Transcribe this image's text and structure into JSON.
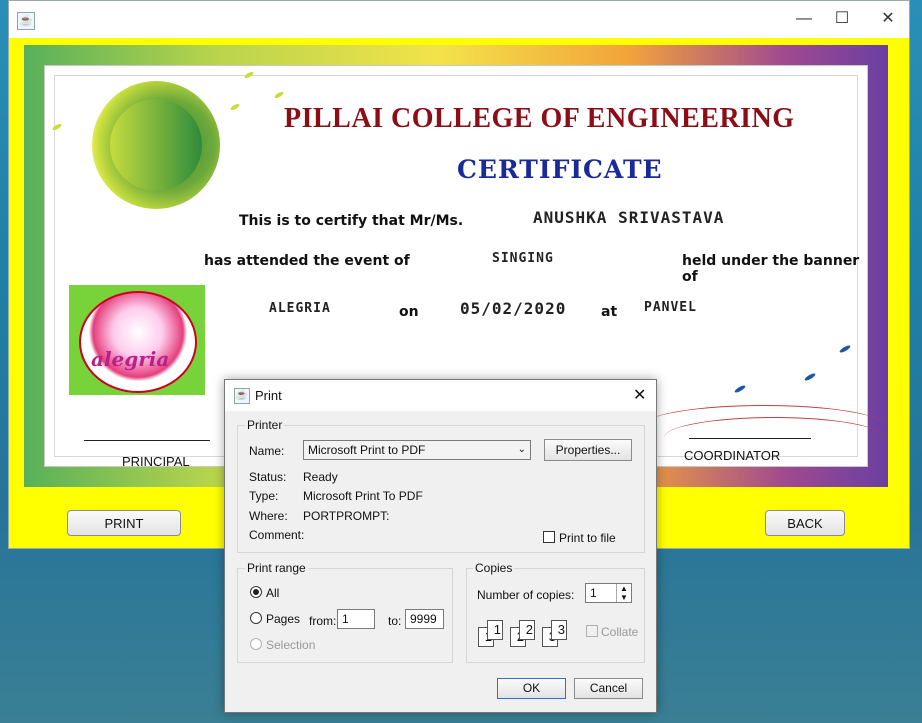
{
  "window": {
    "app_icon": "java-icon",
    "minimize_glyph": "—",
    "maximize_glyph": "☐",
    "close_glyph": "✕"
  },
  "certificate": {
    "college": "PILLAI COLLEGE OF ENGINEERING",
    "title": "CERTIFICATE",
    "line1_label": "This is to certify that Mr/Ms.",
    "name": "ANUSHKA SRIVASTAVA",
    "line2_label": "has attended the event of",
    "event": "SINGING",
    "line2_suffix": "held under the banner of",
    "banner": "ALEGRIA",
    "on_label": "on",
    "date": "05/02/2020",
    "at_label": "at",
    "place": "PANVEL",
    "logo_text": "alegria",
    "principal": "PRINCIPAL",
    "coordinator": "COORDINATOR"
  },
  "buttons": {
    "print": "PRINT",
    "back": "BACK"
  },
  "print_dialog": {
    "title": "Print",
    "printer_group": "Printer",
    "name_label": "Name:",
    "name_value": "Microsoft Print to PDF",
    "properties": "Properties...",
    "status_label": "Status:",
    "status_value": "Ready",
    "type_label": "Type:",
    "type_value": "Microsoft Print To PDF",
    "where_label": "Where:",
    "where_value": "PORTPROMPT:",
    "comment_label": "Comment:",
    "print_to_file": "Print to file",
    "range_group": "Print range",
    "all": "All",
    "pages": "Pages",
    "from_label": "from:",
    "from_value": "1",
    "to_label": "to:",
    "to_value": "9999",
    "selection": "Selection",
    "copies_group": "Copies",
    "copies_label": "Number of copies:",
    "copies_value": "1",
    "collate": "Collate",
    "ok": "OK",
    "cancel": "Cancel",
    "collate_pages": [
      "1",
      "1",
      "2",
      "2",
      "3",
      "3"
    ]
  }
}
